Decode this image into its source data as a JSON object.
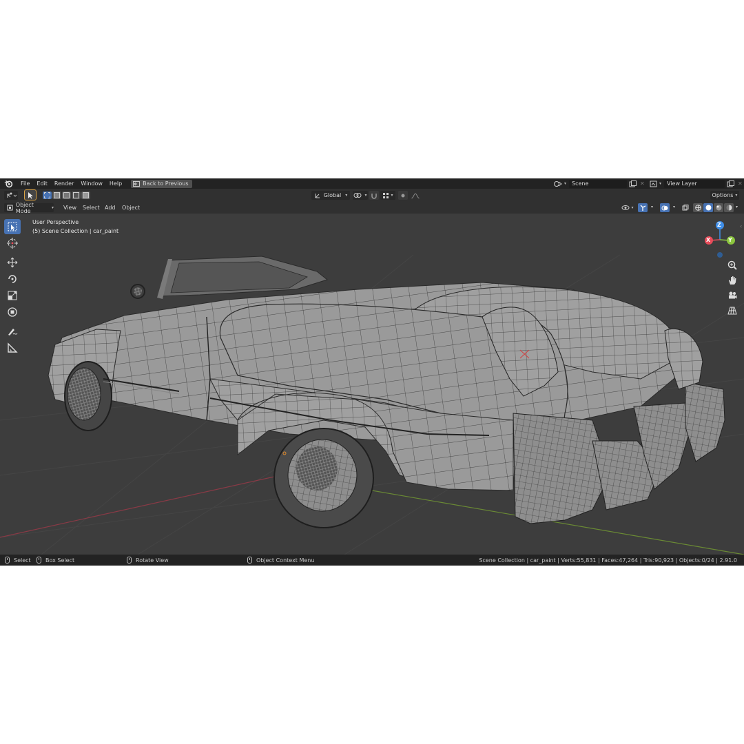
{
  "topbar": {
    "menu": [
      "File",
      "Edit",
      "Render",
      "Window",
      "Help"
    ],
    "back_button": "Back to Previous",
    "scene_name": "Scene",
    "view_layer": "View Layer"
  },
  "header": {
    "orientation": "Global",
    "options_label": "Options"
  },
  "viewport_header": {
    "mode": "Object Mode",
    "menus": [
      "View",
      "Select",
      "Add",
      "Object"
    ]
  },
  "viewport": {
    "perspective": "User Perspective",
    "collection": "(5) Scene Collection | car_paint",
    "gizmo_axes": {
      "z": "Z",
      "y": "Y",
      "x": "X"
    },
    "colors": {
      "x_axis": "#e84c5a",
      "y_axis": "#8cc63f",
      "z_axis": "#3f8ee8",
      "active_tool": "#4772b3"
    }
  },
  "tools": [
    "select-box-icon",
    "cursor-icon",
    "move-icon",
    "rotate-icon",
    "scale-icon",
    "transform-icon",
    "annotate-icon",
    "measure-icon"
  ],
  "status": {
    "select": "Select",
    "box_select": "Box Select",
    "rotate_view": "Rotate View",
    "context_menu": "Object Context Menu",
    "stats": "Scene Collection | car_paint | Verts:55,831 | Faces:47,264 | Tris:90,923 | Objects:0/24 | 2.91.0"
  }
}
